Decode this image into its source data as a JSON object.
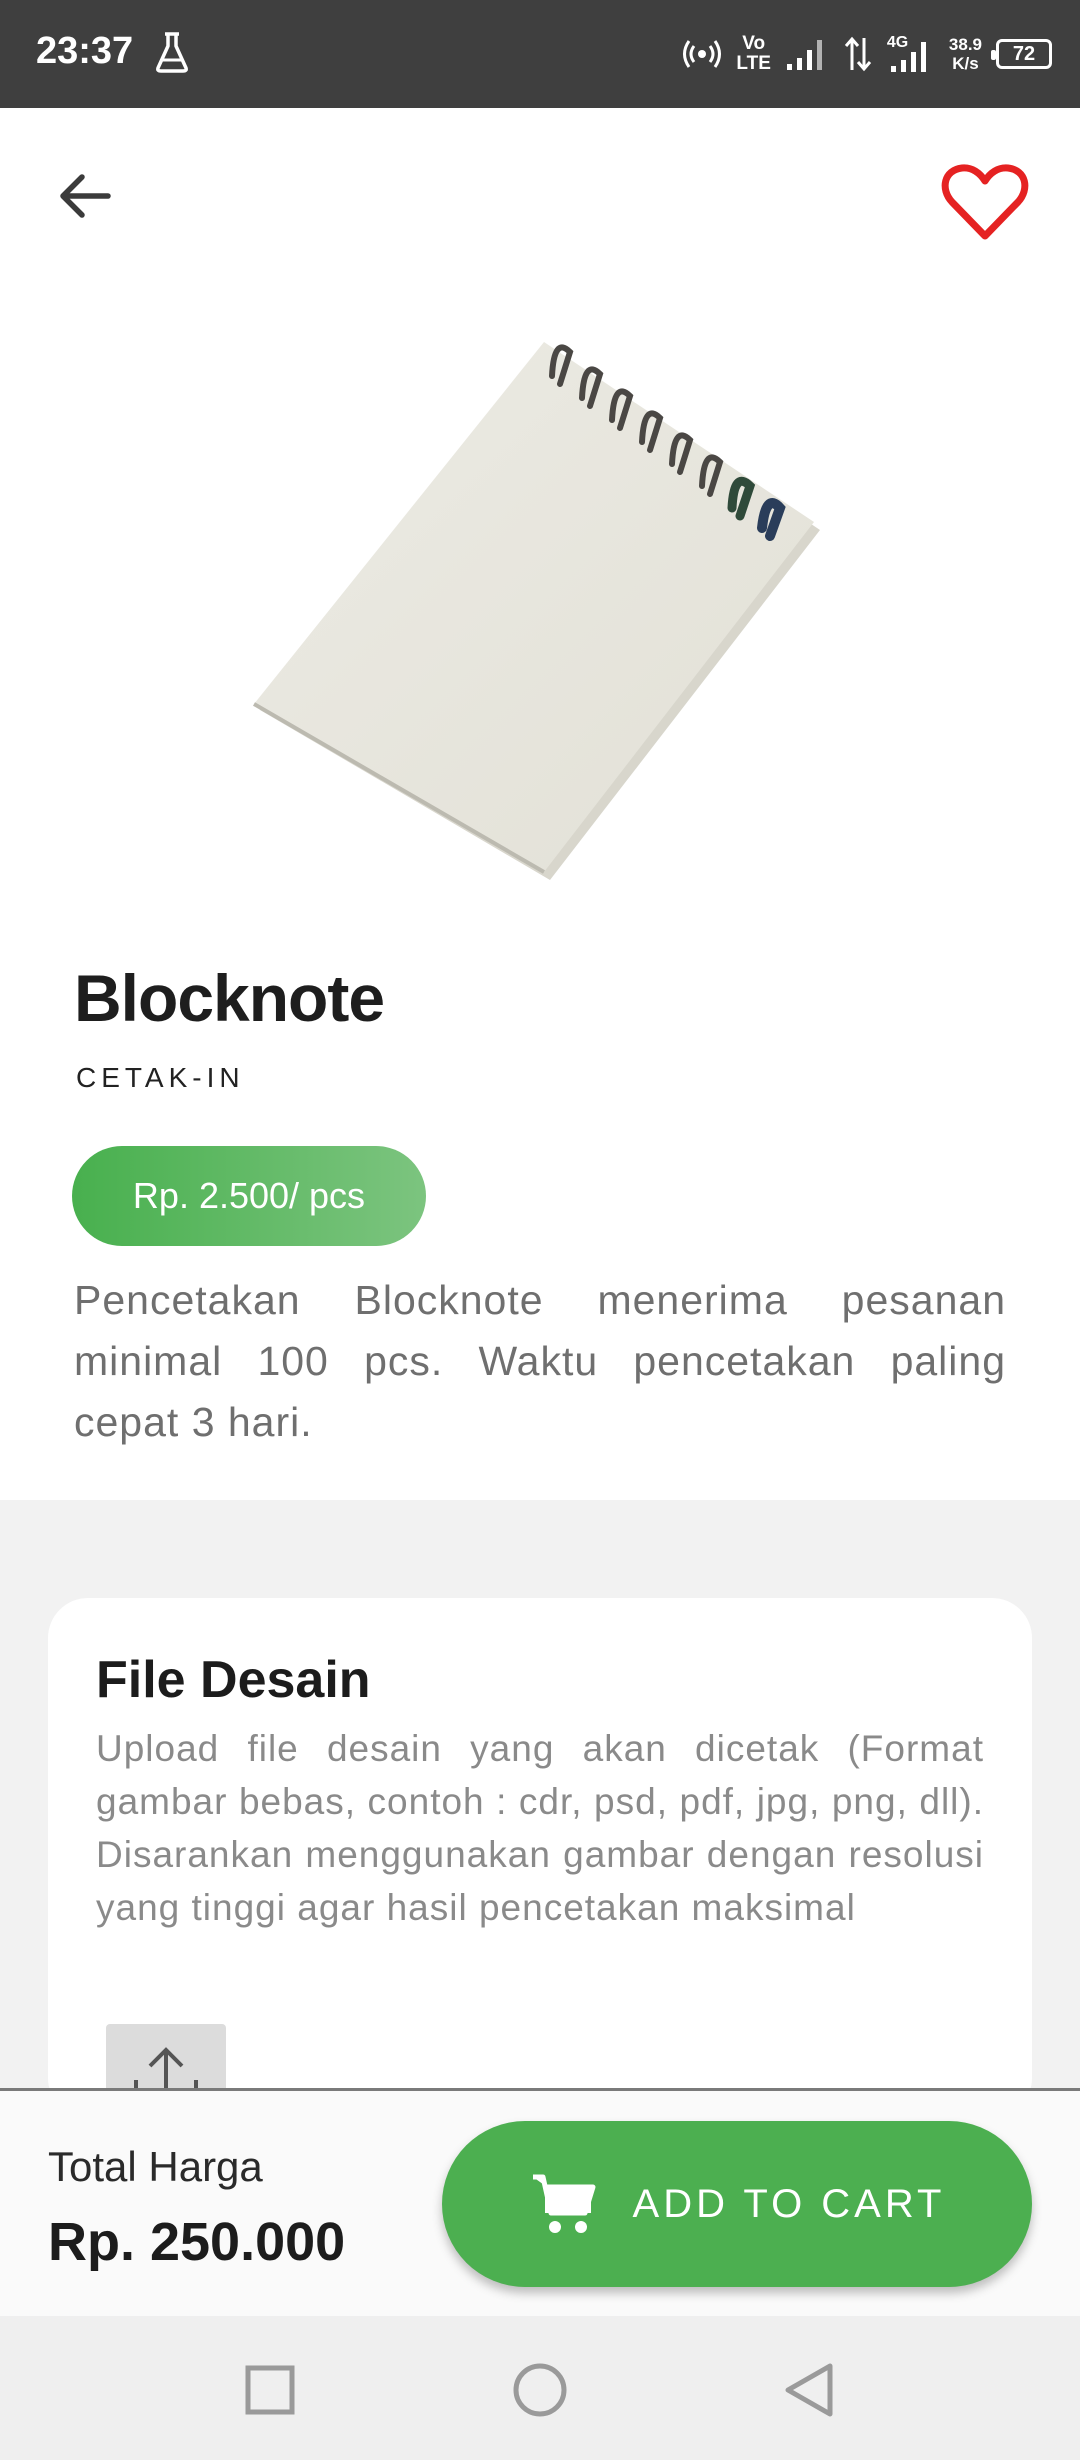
{
  "status_bar": {
    "time": "23:37",
    "network_lte": "Vo\nLTE",
    "network_4g": "4G",
    "speed": "38.9\nK/s",
    "battery": "72"
  },
  "header": {
    "back_icon": "arrow-left-icon",
    "favorite_icon": "heart-outline-icon",
    "favorite_color": "#e52222"
  },
  "product": {
    "title": "Blocknote",
    "brand": "CETAK-IN",
    "price": "Rp. 2.500/ pcs",
    "description": "Pencetakan Blocknote menerima pesanan minimal 100 pcs. Waktu pencetakan paling cepat 3 hari."
  },
  "file_section": {
    "title": "File Desain",
    "description": "Upload file desain yang akan dicetak (Format gambar bebas, contoh : cdr, psd, pdf, jpg, png, dll). Disarankan menggunakan gambar dengan resolusi yang tinggi agar hasil pencetakan maksimal",
    "upload_icon": "upload-icon"
  },
  "bottom_bar": {
    "total_label": "Total Harga",
    "total_value": "Rp. 250.000",
    "add_to_cart_label": "ADD TO CART",
    "accent_color": "#4caf50"
  },
  "nav": {
    "recents_icon": "square-icon",
    "home_icon": "circle-icon",
    "back_icon": "triangle-back-icon"
  }
}
